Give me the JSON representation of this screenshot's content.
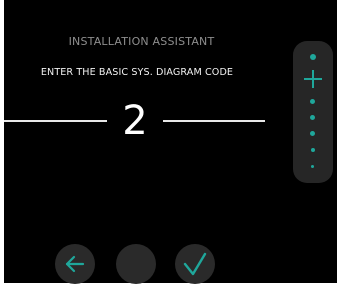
{
  "header": {
    "title": "INSTALLATION ASSISTANT",
    "prompt": "ENTER THE BASIC SYS. DIAGRAM CODE"
  },
  "value_display": {
    "value": "2"
  },
  "stepper": {
    "icon": "plus-icon"
  },
  "footer": {
    "buttons": [
      {
        "icon": "arrow-left-icon"
      },
      {
        "icon": "blank"
      },
      {
        "icon": "check-icon"
      }
    ]
  },
  "colors": {
    "background": "#000000",
    "accent": "#1fa79b",
    "stepper_bg": "#262626",
    "button_bg": "#2a2a2a",
    "title_text": "#8e8e8e",
    "prompt_text": "#f2f2f2"
  }
}
